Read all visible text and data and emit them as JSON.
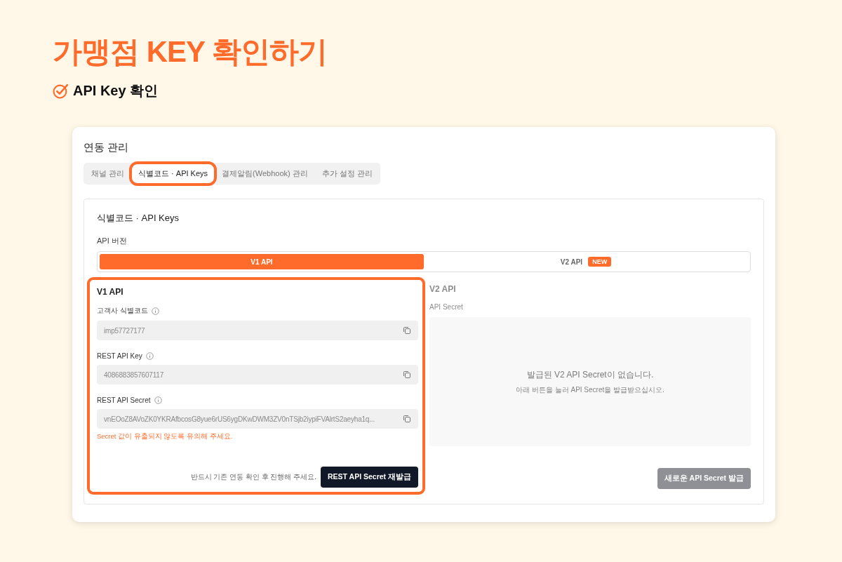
{
  "title": "가맹점 KEY 확인하기",
  "step": {
    "label": "API Key 확인",
    "checked": true
  },
  "card": {
    "title": "연동 관리",
    "tabs": [
      {
        "label": "채널 관리",
        "selected": false,
        "highlighted": false
      },
      {
        "label": "식별코드 · API Keys",
        "selected": true,
        "highlighted": true
      },
      {
        "label": "결제알림(Webhook) 관리",
        "selected": false,
        "highlighted": false
      },
      {
        "label": "추가 설정 관리",
        "selected": false,
        "highlighted": false
      }
    ],
    "panel": {
      "title": "식별코드 · API Keys",
      "version_label": "API 버전",
      "versions": [
        {
          "label": "V1 API",
          "selected": true
        },
        {
          "label": "V2 API",
          "selected": false,
          "badge": "NEW"
        }
      ],
      "v1": {
        "title": "V1 API",
        "highlighted": true,
        "fields": [
          {
            "label": "고객사 식별코드",
            "value": "imp57727177"
          },
          {
            "label": "REST API Key",
            "value": "4086883857607117"
          },
          {
            "label": "REST API Secret",
            "value": "vnEOoZ8AVoZK0YKRAfbcosG8yue6rUS6ygDKwDWM3ZV0nTSjb2iypiFVAlrtS2aeyha1q..."
          }
        ],
        "warning": "Secret 값이 유출되지 않도록 유의해 주세요.",
        "note": "반드시 기존 연동 확인 후 진행해 주세요.",
        "button": "REST API Secret 재발급"
      },
      "v2": {
        "title": "V2 API",
        "disabled": true,
        "field_label": "API Secret",
        "empty_title": "발급된 V2 API Secret이 없습니다.",
        "empty_hint": "아래 버튼을 눌러 API Secret을 발급받으십시오.",
        "button": {
          "label": "새로운 API Secret 발급",
          "disabled": true
        }
      }
    }
  }
}
